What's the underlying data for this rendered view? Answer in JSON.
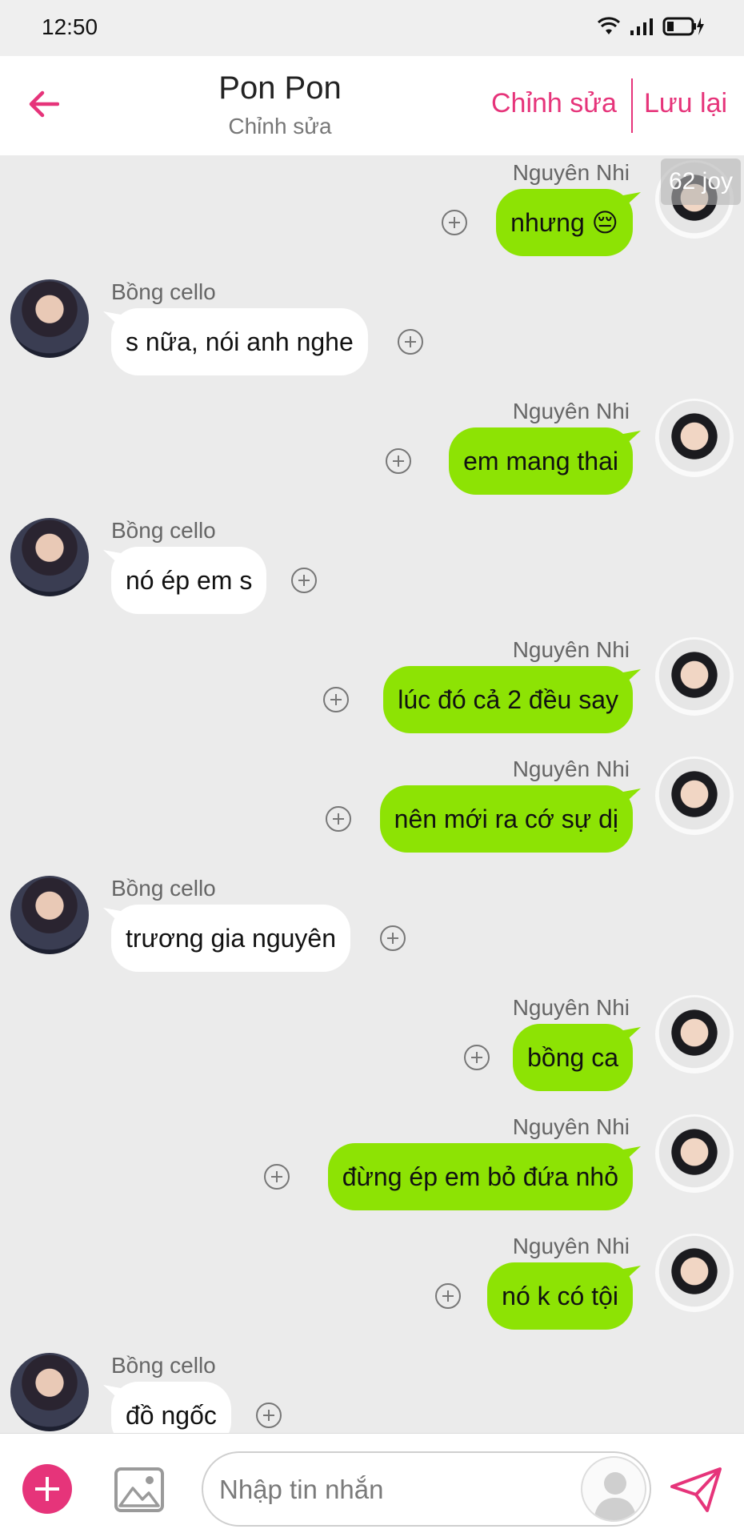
{
  "status_bar": {
    "time": "12:50"
  },
  "header": {
    "title": "Pon Pon",
    "subtitle": "Chỉnh sửa",
    "edit_label": "Chỉnh sửa",
    "save_label": "Lưu lại"
  },
  "badge": {
    "text": "62 joy"
  },
  "messages": [
    {
      "side": "right",
      "sender": "Nguyên Nhi",
      "text": "nhưng 😔"
    },
    {
      "side": "left",
      "sender": "Bồng cello",
      "text": "s nữa, nói anh nghe"
    },
    {
      "side": "right",
      "sender": "Nguyên Nhi",
      "text": "em mang thai"
    },
    {
      "side": "left",
      "sender": "Bồng cello",
      "text": "nó ép em s"
    },
    {
      "side": "right",
      "sender": "Nguyên Nhi",
      "text": "lúc đó cả 2 đều say"
    },
    {
      "side": "right",
      "sender": "Nguyên Nhi",
      "text": "nên mới ra cớ sự dị"
    },
    {
      "side": "left",
      "sender": "Bồng cello",
      "text": "trương gia nguyên"
    },
    {
      "side": "right",
      "sender": "Nguyên Nhi",
      "text": "bồng ca"
    },
    {
      "side": "right",
      "sender": "Nguyên Nhi",
      "text": "đừng ép em bỏ đứa nhỏ"
    },
    {
      "side": "right",
      "sender": "Nguyên Nhi",
      "text": "nó k có tội"
    },
    {
      "side": "left",
      "sender": "Bồng cello",
      "text": "đồ ngốc"
    }
  ],
  "composer": {
    "placeholder": "Nhập tin nhắn"
  },
  "colors": {
    "accent": "#e6347a",
    "bubble_mine": "#8de304",
    "bubble_other": "#ffffff",
    "background": "#ebebeb"
  }
}
